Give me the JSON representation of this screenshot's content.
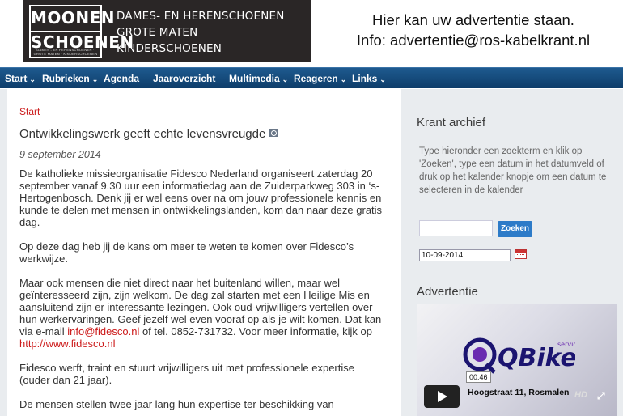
{
  "banner": {
    "ad_left": {
      "logo_line1": "MOONEN",
      "logo_line2": "SCHOENEN",
      "logo_sub": "DAMES - EN HERENSCHOENEN · GROTE MATEN · KINDERSCHOENEN",
      "lines": [
        "DAMES- EN HERENSCHOENEN",
        "GROTE MATEN",
        "KINDERSCHOENEN"
      ]
    },
    "ad_right": {
      "line1": "Hier kan uw advertentie staan.",
      "line2": "Info: advertentie@ros-kabelkrant.nl"
    }
  },
  "nav": {
    "items": [
      {
        "label": "Start",
        "dropdown": true
      },
      {
        "label": "Rubrieken",
        "dropdown": true
      },
      {
        "label": "Agenda",
        "dropdown": false
      },
      {
        "label": "Jaaroverzicht",
        "dropdown": false
      },
      {
        "label": "Multimedia",
        "dropdown": true
      },
      {
        "label": "Reageren",
        "dropdown": true
      },
      {
        "label": "Links",
        "dropdown": true
      }
    ],
    "caret": "⌄"
  },
  "article": {
    "breadcrumb": "Start",
    "title": "Ontwikkelingswerk geeft echte levensvreugde",
    "date": "9 september 2014",
    "p1": "De katholieke missieorganisatie Fidesco Nederland organiseert zaterdag 20 september vanaf 9.30 uur een informatiedag aan de Zuiderparkweg 303 in ‘s-Hertogenbosch. Denk jij er wel eens over na om jouw professionele kennis en kunde te delen met mensen in ontwikkelingslanden, kom dan naar deze gratis dag.",
    "p2": "Op deze dag heb jij de kans om meer te weten te komen over Fidesco’s werkwijze.",
    "p3_a": "Maar ook mensen die niet direct naar het buitenland willen, maar wel geïnteresseerd zijn, zijn welkom. De dag zal starten met een Heilige Mis en aansluitend zijn er interessante lezingen. Ook oud-vrijwilligers vertellen over hun werkervaringen. Geef jezelf wel even vooraf op als je wilt komen. Dat kan via e-mail ",
    "p3_email": "info@fidesco.nl",
    "p3_b": " of tel. 0852-731732. Voor meer informatie, kijk op",
    "p3_link": "http://www.fidesco.nl",
    "p4": "Fidesco werft, traint en stuurt vrijwilligers uit met professionele expertise (ouder dan 21 jaar).",
    "p5": "De mensen stellen twee jaar lang hun expertise ter beschikking van"
  },
  "sidebar": {
    "archive_heading": "Krant archief",
    "archive_desc": "Type hieronder een zoekterm en klik op 'Zoeken', type een datum in het datumveld of druk op het kalender knopje om een datum te selecteren in de kalender",
    "search_placeholder": "",
    "search_button": "Zoeken",
    "date_value": "10-09-2014",
    "ad_heading": "Advertentie",
    "video": {
      "timestamp": "00:46",
      "caption": "Hoogstraat 11, Rosmalen",
      "hd_label": "HD",
      "logo_text": "QBike",
      "logo_sub": "service"
    }
  },
  "colors": {
    "nav_bg": "#123f6c",
    "link_red": "#cc1b1b",
    "button_blue": "#2d7bc8",
    "sidebar_bg": "#e9ecef"
  }
}
